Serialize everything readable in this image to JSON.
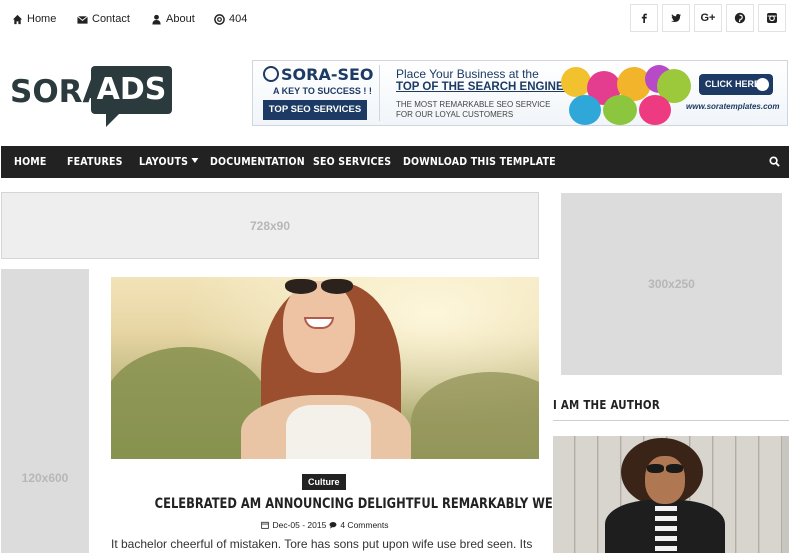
{
  "topnav": {
    "links": [
      {
        "label": "Home",
        "icon": "home-icon"
      },
      {
        "label": "Contact",
        "icon": "envelope-icon"
      },
      {
        "label": "About",
        "icon": "user-icon"
      },
      {
        "label": "404",
        "icon": "lifebuoy-icon"
      }
    ],
    "social": [
      {
        "label": "f",
        "icon": "facebook-icon"
      },
      {
        "label": "t",
        "icon": "twitter-icon"
      },
      {
        "label": "G+",
        "icon": "googleplus-icon"
      },
      {
        "label": "p",
        "icon": "pinterest-icon"
      },
      {
        "label": "ig",
        "icon": "instagram-icon"
      }
    ]
  },
  "logo": {
    "part1": "SORA",
    "part2": "ADS",
    "colors": {
      "dark": "#2a3a3d",
      "light": "#ffffff"
    }
  },
  "banner": {
    "brand": "SORA-SEO",
    "tagline": "A KEY TO SUCCESS ! !",
    "badge": "TOP SEO SERVICES",
    "headline1": "Place Your Business at the",
    "headline2": "TOP OF THE SEARCH ENGINES",
    "subline": "THE MOST REMARKABLE SEO SERVICE FOR OUR LOYAL CUSTOMERS",
    "cta": "CLICK HERE",
    "url": "www.soratemplates.com"
  },
  "mainnav": {
    "items": [
      "HOME",
      "FEATURES",
      "LAYOUTS",
      "DOCUMENTATION",
      "SEO SERVICES",
      "DOWNLOAD THIS TEMPLATE"
    ],
    "background": "#222222"
  },
  "ads": {
    "leaderboard": "728x90",
    "sidebar": "300x250",
    "skyscraper": "120x600"
  },
  "post": {
    "category": "Culture",
    "title": "CELEBRATED AM ANNOUNCING DELIGHTFUL REMARKABLY WE",
    "date": "Dec-05 - 2015",
    "comments": "4 Comments",
    "excerpt": "It bachelor cheerful of mistaken. Tore has sons put upon wife use bred seen. Its"
  },
  "sidebar": {
    "author_title": "I AM THE AUTHOR"
  }
}
